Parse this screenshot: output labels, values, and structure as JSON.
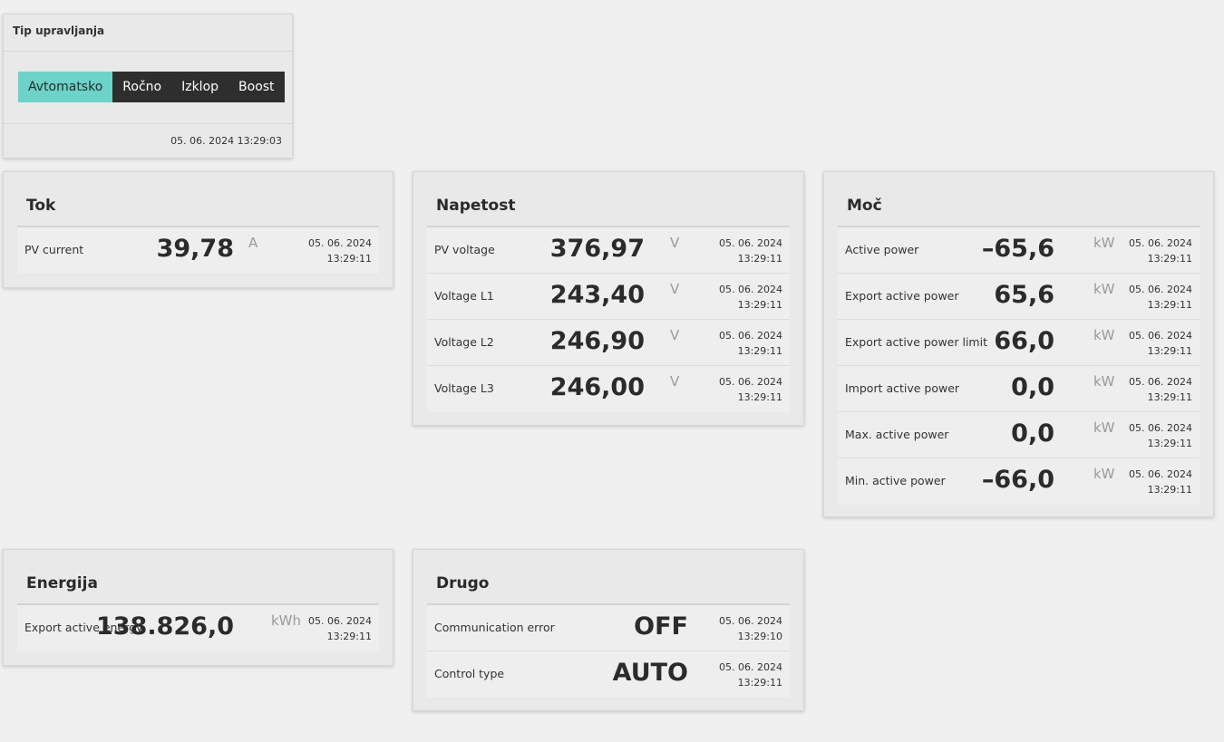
{
  "control": {
    "title": "Tip upravljanja",
    "buttons": [
      "Avtomatsko",
      "Ročno",
      "Izklop",
      "Boost"
    ],
    "active": "Avtomatsko",
    "timestamp": "05. 06. 2024 13:29:03"
  },
  "tok": {
    "title": "Tok",
    "rows": [
      {
        "label": "PV current",
        "value": "39,78",
        "unit": "A",
        "date": "05. 06. 2024",
        "time": "13:29:11"
      }
    ]
  },
  "napetost": {
    "title": "Napetost",
    "rows": [
      {
        "label": "PV voltage",
        "value": "376,97",
        "unit": "V",
        "date": "05. 06. 2024",
        "time": "13:29:11"
      },
      {
        "label": "Voltage L1",
        "value": "243,40",
        "unit": "V",
        "date": "05. 06. 2024",
        "time": "13:29:11"
      },
      {
        "label": "Voltage L2",
        "value": "246,90",
        "unit": "V",
        "date": "05. 06. 2024",
        "time": "13:29:11"
      },
      {
        "label": "Voltage L3",
        "value": "246,00",
        "unit": "V",
        "date": "05. 06. 2024",
        "time": "13:29:11"
      }
    ]
  },
  "moc": {
    "title": "Moč",
    "rows": [
      {
        "label": "Active power",
        "value": "–65,6",
        "unit": "kW",
        "date": "05. 06. 2024",
        "time": "13:29:11"
      },
      {
        "label": "Export active power",
        "value": "65,6",
        "unit": "kW",
        "date": "05. 06. 2024",
        "time": "13:29:11"
      },
      {
        "label": "Export active power limit",
        "value": "66,0",
        "unit": "kW",
        "date": "05. 06. 2024",
        "time": "13:29:11"
      },
      {
        "label": "Import active power",
        "value": "0,0",
        "unit": "kW",
        "date": "05. 06. 2024",
        "time": "13:29:11"
      },
      {
        "label": "Max. active power",
        "value": "0,0",
        "unit": "kW",
        "date": "05. 06. 2024",
        "time": "13:29:11"
      },
      {
        "label": "Min. active power",
        "value": "–66,0",
        "unit": "kW",
        "date": "05. 06. 2024",
        "time": "13:29:11"
      }
    ]
  },
  "energija": {
    "title": "Energija",
    "rows": [
      {
        "label": "Export active energy",
        "value": "138.826,0",
        "unit": "kWh",
        "date": "05. 06. 2024",
        "time": "13:29:11"
      }
    ]
  },
  "drugo": {
    "title": "Drugo",
    "rows": [
      {
        "label": "Communication error",
        "value": "OFF",
        "unit": "",
        "date": "05. 06. 2024",
        "time": "13:29:10"
      },
      {
        "label": "Control type",
        "value": "AUTO",
        "unit": "",
        "date": "05. 06. 2024",
        "time": "13:29:11"
      }
    ]
  },
  "colors": {
    "accent": "#6dd2c8",
    "dark_button": "#2e2e2e",
    "background": "#f0f0f0"
  }
}
